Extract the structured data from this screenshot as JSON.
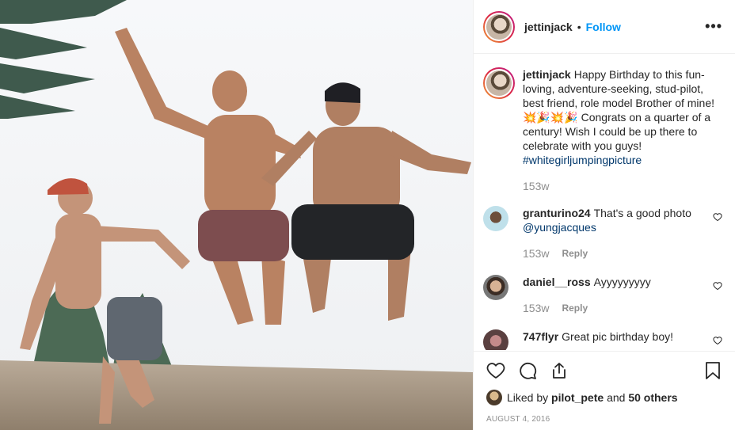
{
  "post": {
    "username": "jettinjack",
    "separator": "•",
    "follow_label": "Follow",
    "more_icon": "more-horizontal-icon",
    "more_label": "•••"
  },
  "caption": {
    "username": "jettinjack",
    "text_part1": "Happy Birthday to this fun-loving, adventure-seeking, stud-pilot, best friend, role model Brother of mine! ",
    "emoji": "💥🎉💥🎉",
    "text_part2": " Congrats on a quarter of a century! Wish I could be up there to celebrate with you guys! ",
    "hashtag": "#whitegirljumpingpicture",
    "time": "153w"
  },
  "comments": [
    {
      "username": "granturino24",
      "text": "That's a good photo ",
      "mention": "@yungjacques",
      "time": "153w",
      "reply_label": "Reply"
    },
    {
      "username": "daniel__ross",
      "text": "Ayyyyyyyyy",
      "mention": "",
      "time": "153w",
      "reply_label": "Reply"
    },
    {
      "username": "747flyr",
      "text": "Great pic birthday boy!",
      "mention": "",
      "time": "",
      "reply_label": ""
    }
  ],
  "actions": {
    "icons": [
      "heart-icon",
      "comment-icon",
      "share-icon",
      "bookmark-icon"
    ]
  },
  "likes": {
    "prefix": "Liked by",
    "user": "pilot_pete",
    "conj": "and",
    "others": "50 others"
  },
  "date": "August 4, 2016",
  "colors": {
    "accent": "#0095f6",
    "text": "#262626",
    "muted": "#8e8e8e",
    "border": "#efefef",
    "link": "#00376b"
  }
}
